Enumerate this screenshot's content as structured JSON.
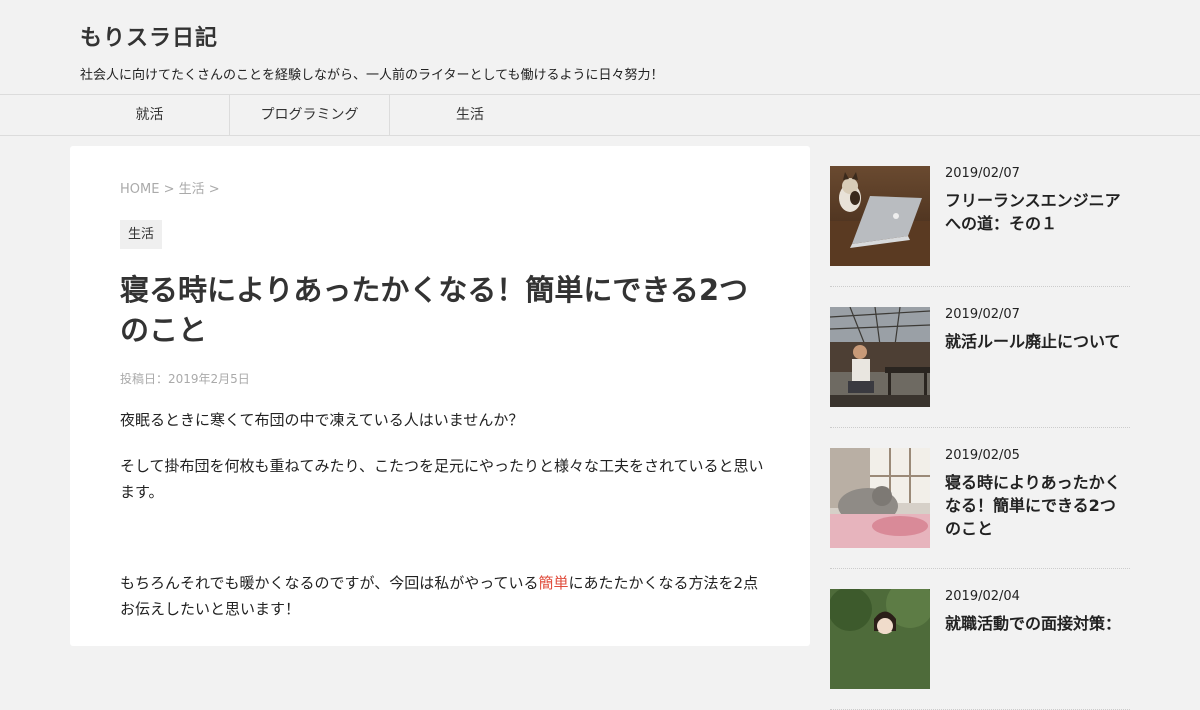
{
  "site": {
    "title": "もりスラ日記",
    "tagline": "社会人に向けてたくさんのことを経験しながら、一人前のライターとしても働けるように日々努力！"
  },
  "nav": {
    "items": [
      {
        "label": "就活"
      },
      {
        "label": "プログラミング"
      },
      {
        "label": "生活"
      }
    ]
  },
  "article": {
    "breadcrumb": {
      "home": "HOME",
      "sep": ">",
      "category": "生活",
      "trail_sep": ">"
    },
    "category_badge": "生活",
    "title": "寝る時によりあったかくなる！簡単にできる2つのこと",
    "date": "投稿日：2019年2月5日",
    "paragraphs": {
      "p1": "夜眠るときに寒くて布団の中で凍えている人はいませんか？",
      "p2": "そして掛布団を何枚も重ねてみたり、こたつを足元にやったりと様々な工夫をされていると思います。",
      "p3_before": "もちろんそれでも暖かくなるのですが、今回は私がやっている",
      "p3_link": "簡単",
      "p3_after": "にあたたかくなる方法を2点お伝えしたいと思います！"
    }
  },
  "sidebar": {
    "posts": [
      {
        "date": "2019/02/07",
        "title": "フリーランスエンジニアへの道：その１",
        "thumb_icon": "cat-laptop-photo"
      },
      {
        "date": "2019/02/07",
        "title": "就活ルール廃止について",
        "thumb_icon": "man-on-bench-photo"
      },
      {
        "date": "2019/02/05",
        "title": "寝る時によりあったかくなる！簡単にできる2つのこと",
        "thumb_icon": "sleeping-cat-photo"
      },
      {
        "date": "2019/02/04",
        "title": "就職活動での面接対策：",
        "thumb_icon": "woman-trees-photo"
      }
    ]
  },
  "colors": {
    "page_bg": "#f2f2f2",
    "card_bg": "#ffffff",
    "link_highlight": "#e04c3c",
    "muted_text": "#aaaaaa"
  }
}
